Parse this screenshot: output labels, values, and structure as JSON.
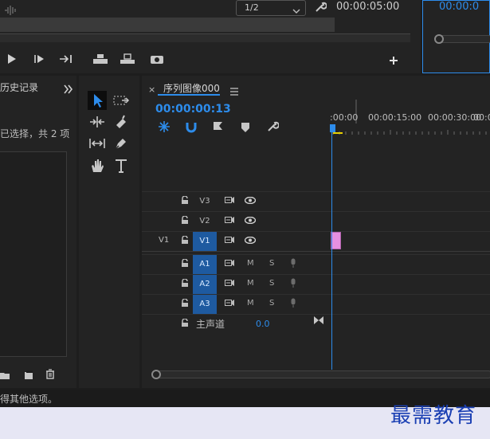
{
  "program_monitor": {
    "zoom_select": "1/2",
    "duration": "00:00:05:00",
    "right_timecode": "00:00:0"
  },
  "history_panel": {
    "title": "历史记录",
    "subtitle": "已选择，共 2 项"
  },
  "timeline": {
    "sequence_title": "序列图像000",
    "current_timecode": "00:00:00:13",
    "ruler": [
      ":00:00",
      "00:00:15:00",
      "00:00:30:00",
      "00:0"
    ],
    "tracks_video": [
      {
        "name": "V3",
        "source": "",
        "active": false
      },
      {
        "name": "V2",
        "source": "",
        "active": false
      },
      {
        "name": "V1",
        "source": "V1",
        "active": true
      }
    ],
    "tracks_audio": [
      {
        "name": "A1",
        "mute": "M",
        "solo": "S",
        "active": true
      },
      {
        "name": "A2",
        "mute": "M",
        "solo": "S",
        "active": true
      },
      {
        "name": "A3",
        "mute": "M",
        "solo": "S",
        "active": true
      }
    ],
    "master_track": {
      "name": "主声道",
      "value": "0.0"
    }
  },
  "status_bar": {
    "text": "得其他选项。"
  },
  "watermark": "最需教育",
  "colors": {
    "accent": "#2d8ceb",
    "clip": "#e78fe0",
    "track_active": "#1e5aa0",
    "panel": "#232323",
    "background": "#1d1d1d"
  }
}
